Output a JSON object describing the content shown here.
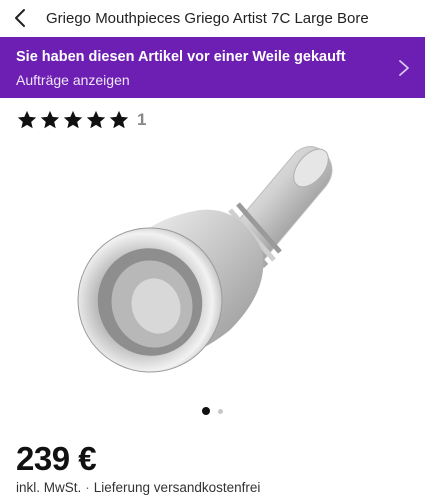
{
  "header": {
    "title": "Griego Mouthpieces Griego Artist 7C Large Bore",
    "back_icon": "chevron-left-icon"
  },
  "banner": {
    "title": "Sie haben diesen Artikel vor einer Weile gekauft",
    "link": "Aufträge anzeigen",
    "background": "#6e1fb3",
    "chevron_icon": "chevron-right-icon"
  },
  "rating": {
    "stars": 5,
    "max_stars": 5,
    "count": "1"
  },
  "gallery": {
    "image_alt": "silver trombone mouthpiece",
    "current_index": 1,
    "total": 2
  },
  "price": {
    "amount": "239 €",
    "vat_note": "inkl. MwSt.",
    "separator": "·",
    "shipping": "Lieferung versandkostenfrei"
  }
}
